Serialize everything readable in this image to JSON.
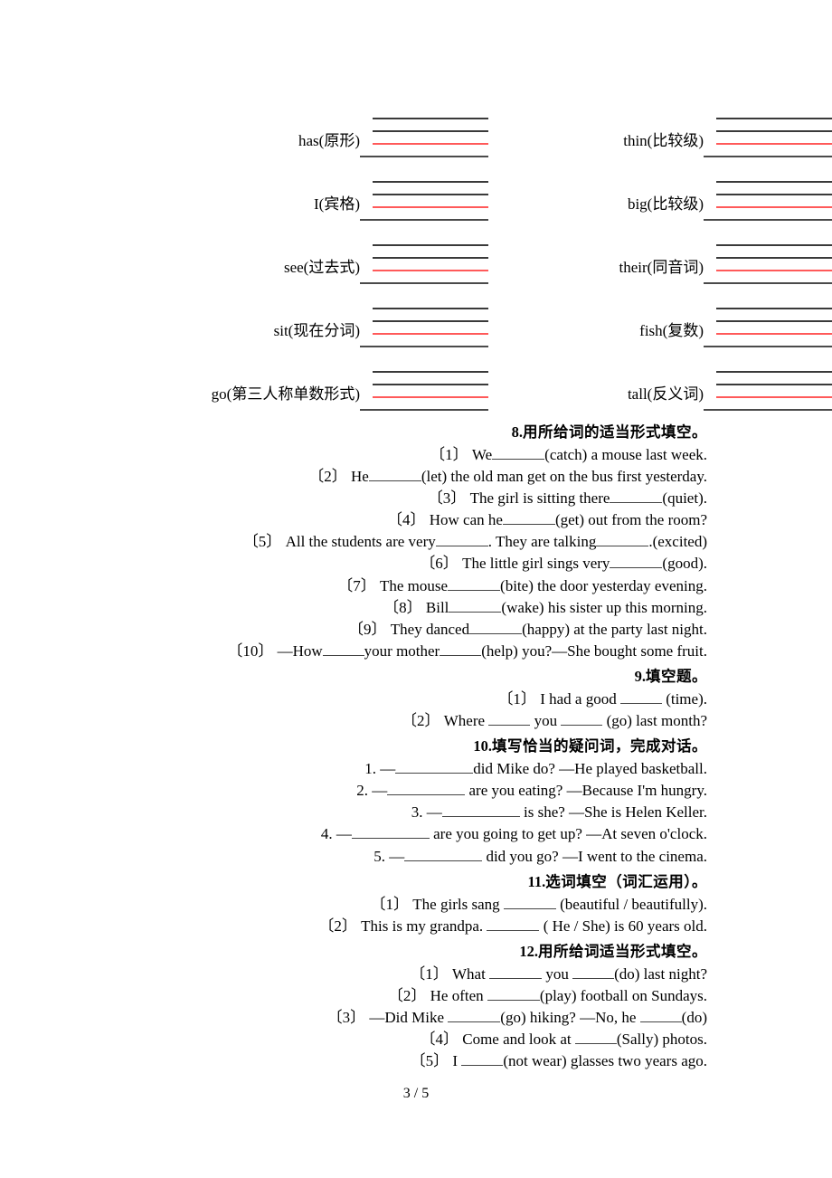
{
  "page": {
    "footer": "3 / 5"
  },
  "word_form_exercise": {
    "left_column": [
      {
        "label": "has(原形)"
      },
      {
        "label": "I(宾格)"
      },
      {
        "label": "see(过去式)"
      },
      {
        "label": "sit(现在分词)"
      },
      {
        "label": "go(第三人称单数形式)"
      }
    ],
    "right_column": [
      {
        "label": "thin(比较级)"
      },
      {
        "label": "big(比较级)"
      },
      {
        "label": "their(同音词)"
      },
      {
        "label": "fish(复数)"
      },
      {
        "label": "tall(反义词)"
      }
    ],
    "rule_colors": {
      "dark": "#3a3a3a",
      "red": "#ff5a5a"
    }
  },
  "sections": [
    {
      "number": "8.",
      "title": "用所给词的适当形式填空。",
      "items": [
        {
          "marker": "〔1〕",
          "pre": "We",
          "mid": "(catch) a mouse last week.",
          "post": ""
        },
        {
          "marker": "〔2〕",
          "pre": "He",
          "mid": "(let) the old man get on the bus first yesterday.",
          "post": ""
        },
        {
          "marker": "〔3〕",
          "pre": "The girl is sitting there",
          "mid": "(quiet).",
          "post": ""
        },
        {
          "marker": "〔4〕",
          "pre": "How can he",
          "mid": "(get) out from the room?",
          "post": ""
        },
        {
          "marker": "〔5〕",
          "pre": "All the students are very",
          "mid": ". They are talking",
          "post": ".(excited)"
        },
        {
          "marker": "〔6〕",
          "pre": "The little girl sings very",
          "mid": "(good).",
          "post": ""
        },
        {
          "marker": "〔7〕",
          "pre": "The mouse",
          "mid": "(bite) the door yesterday evening.",
          "post": ""
        },
        {
          "marker": "〔8〕",
          "pre": "Bill",
          "mid": "(wake) his sister up this morning.",
          "post": ""
        },
        {
          "marker": "〔9〕",
          "pre": "They danced",
          "mid": "(happy) at the party last night.",
          "post": ""
        },
        {
          "marker": "〔10〕",
          "pre": "—How",
          "mid": "your mother",
          "post": "(help) you?—She bought some fruit."
        }
      ]
    },
    {
      "number": "9.",
      "title": "填空题。",
      "items": [
        {
          "marker": "〔1〕",
          "pre": "I had a good",
          "mid": "(time).",
          "post": ""
        },
        {
          "marker": "〔2〕",
          "pre": "Where",
          "mid": "you",
          "post": "(go) last month?"
        }
      ]
    },
    {
      "number": "10.",
      "title": "填写恰当的疑问词，完成对话。",
      "items": [
        {
          "marker": "1.",
          "pre": "—",
          "mid": "did Mike do? —He played basketball.",
          "post": ""
        },
        {
          "marker": "2.",
          "pre": "—",
          "mid": " are you eating? —Because I'm hungry.",
          "post": ""
        },
        {
          "marker": "3.",
          "pre": "—",
          "mid": " is she?  —She is Helen Keller.",
          "post": ""
        },
        {
          "marker": "4.",
          "pre": "—",
          "mid": " are you going to get up? —At seven o'clock.",
          "post": ""
        },
        {
          "marker": "5.",
          "pre": "—",
          "mid": " did you go? —I went to the cinema.",
          "post": ""
        }
      ]
    },
    {
      "number": "11.",
      "title": "选词填空（词汇运用）。",
      "items": [
        {
          "marker": "〔1〕",
          "pre": "The girls sang",
          "mid": " (beautiful / beautifully).",
          "post": ""
        },
        {
          "marker": "〔2〕",
          "pre": "This is my grandpa.",
          "mid": " ( He / She) is 60 years old.",
          "post": ""
        }
      ]
    },
    {
      "number": "12.",
      "title": "用所给词适当形式填空。",
      "items": [
        {
          "marker": "〔1〕",
          "pre": "What",
          "mid": "you",
          "post": "(do) last night?"
        },
        {
          "marker": "〔2〕",
          "pre": "He often",
          "mid": "(play) football on Sundays.",
          "post": ""
        },
        {
          "marker": "〔3〕",
          "pre": "—Did Mike",
          "mid": "(go) hiking? —No, he",
          "post": "(do)"
        },
        {
          "marker": "〔4〕",
          "pre": "Come and look at",
          "mid": "(Sally) photos.",
          "post": ""
        },
        {
          "marker": "〔5〕",
          "pre": "I",
          "mid": "(not wear) glasses two years ago.",
          "post": ""
        }
      ]
    }
  ]
}
